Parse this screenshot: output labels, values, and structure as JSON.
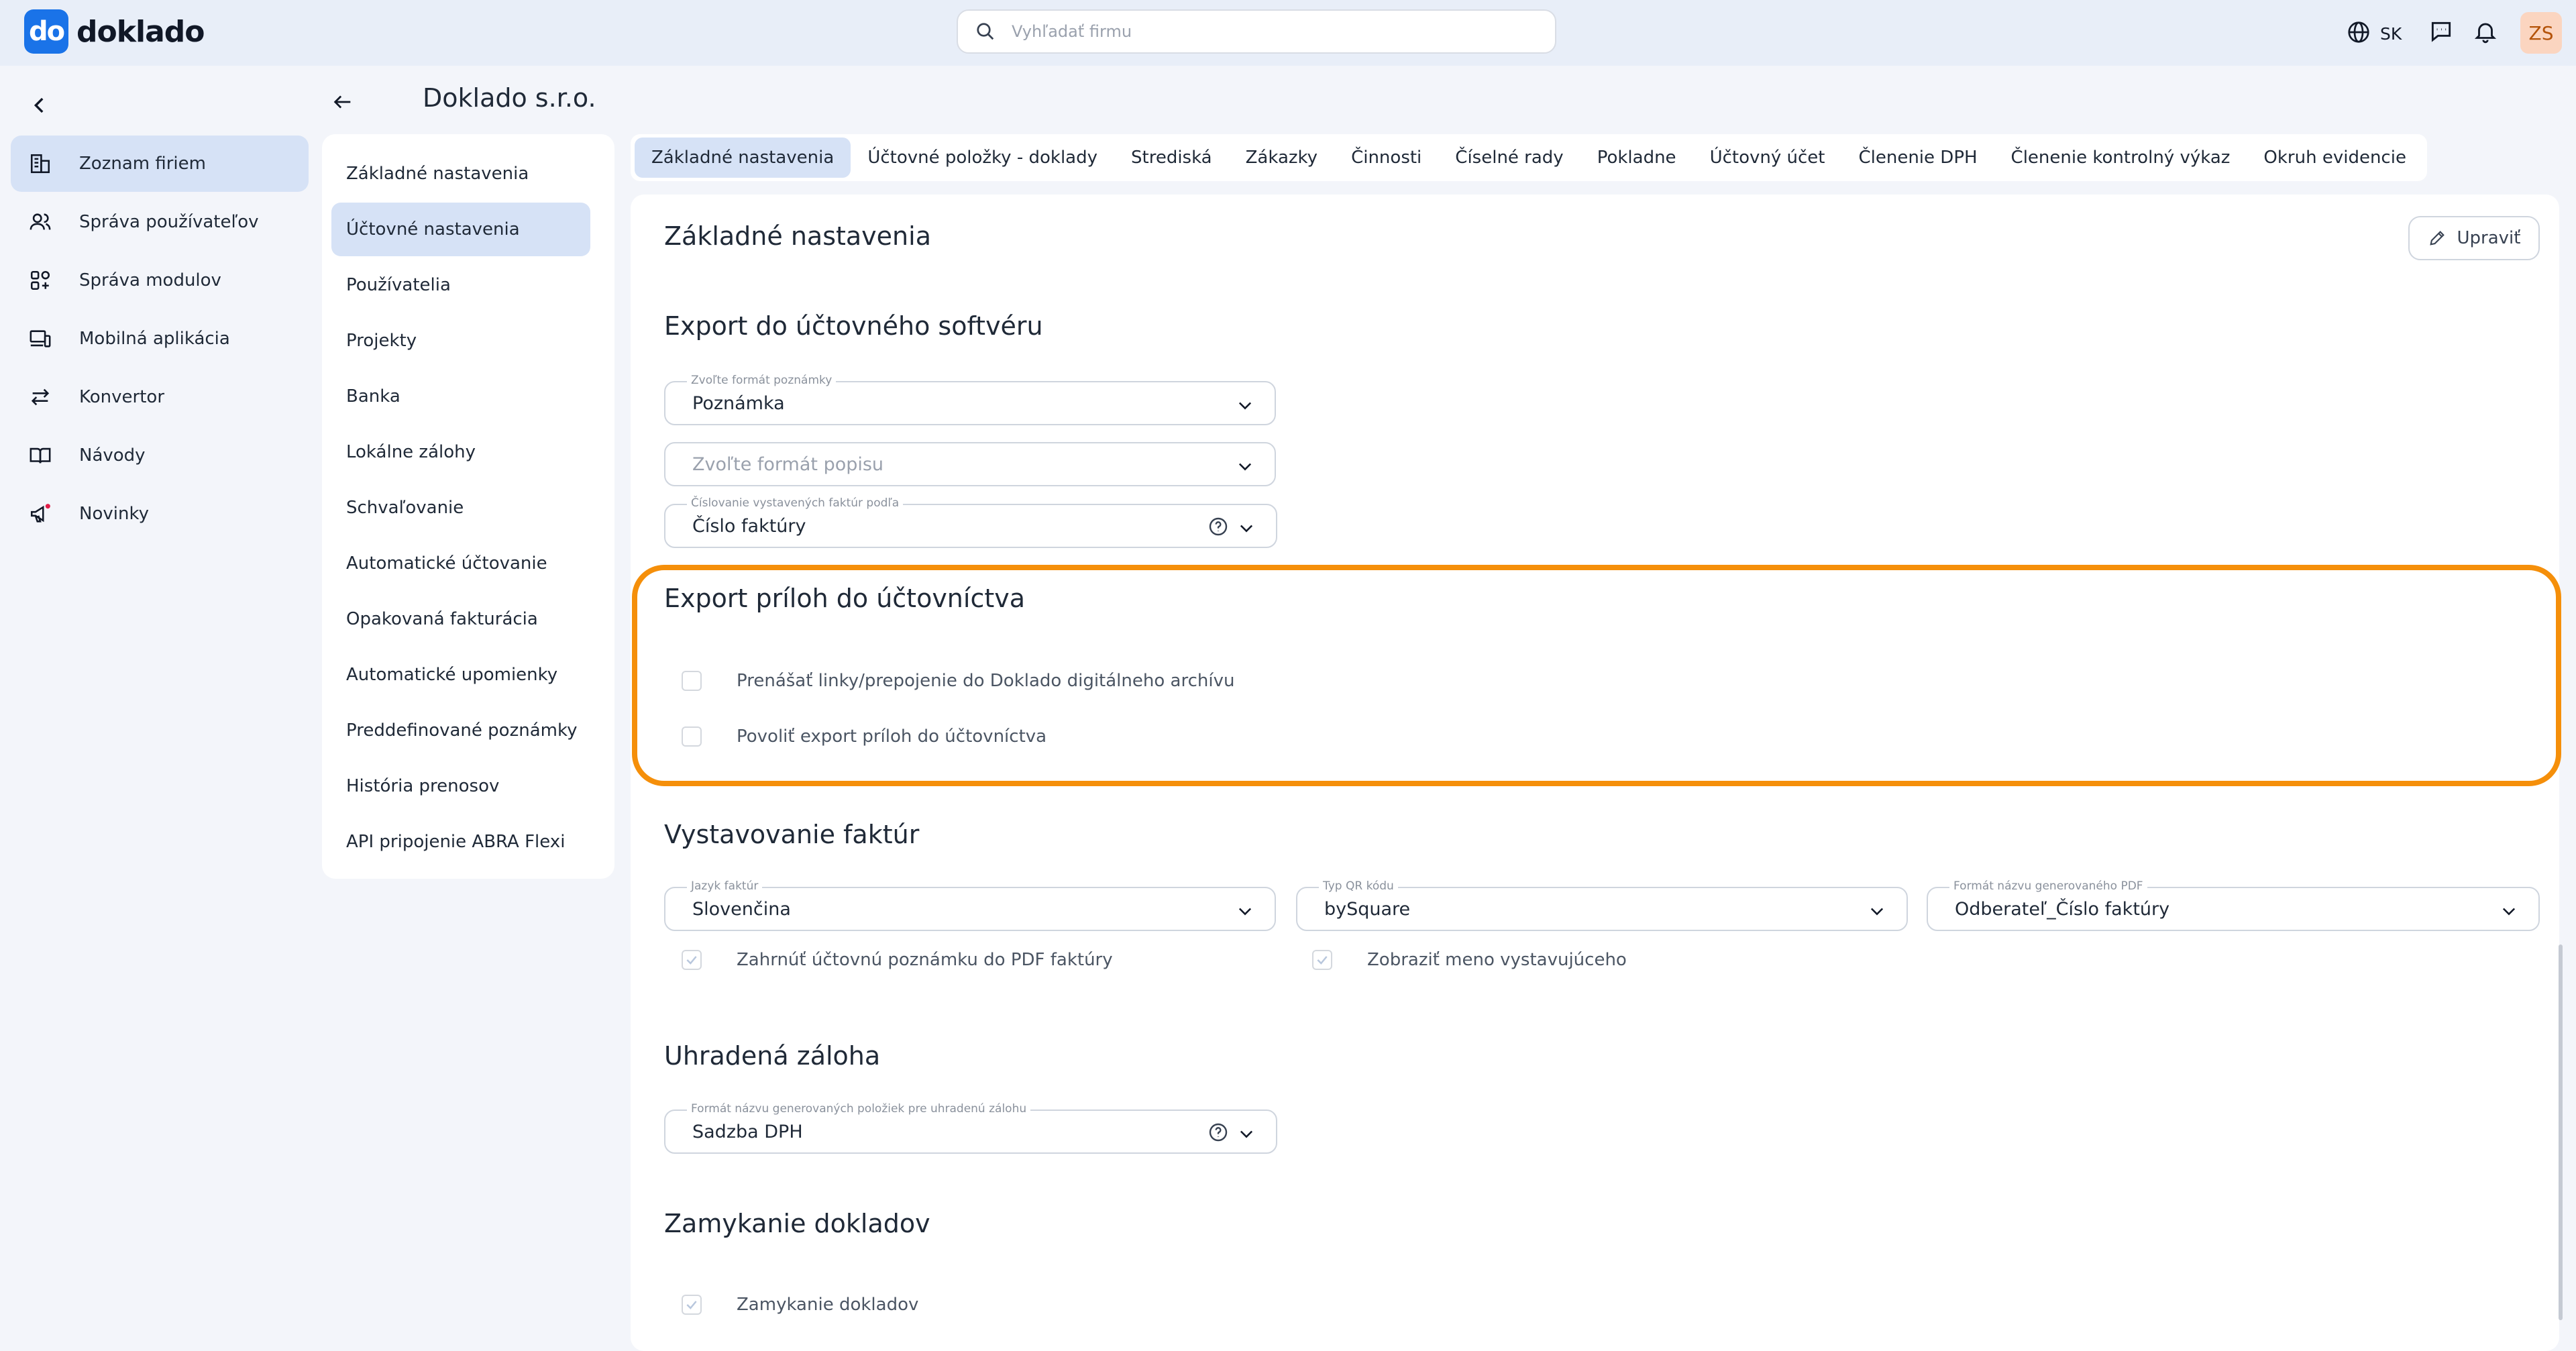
{
  "brand": {
    "logo_mark": "do",
    "name": "doklado"
  },
  "search": {
    "placeholder": "Vyhľadať firmu"
  },
  "header": {
    "lang": "SK",
    "avatar": "ZS"
  },
  "nav": {
    "items": [
      {
        "label": "Zoznam firiem",
        "icon": "building-icon"
      },
      {
        "label": "Správa používateľov",
        "icon": "users-icon"
      },
      {
        "label": "Správa modulov",
        "icon": "modules-icon"
      },
      {
        "label": "Mobilná aplikácia",
        "icon": "devices-icon"
      },
      {
        "label": "Konvertor",
        "icon": "convert-icon"
      },
      {
        "label": "Návody",
        "icon": "book-icon"
      },
      {
        "label": "Novinky",
        "icon": "megaphone-icon"
      }
    ]
  },
  "company": {
    "title": "Doklado s.r.o."
  },
  "submenu": {
    "items": [
      "Základné nastavenia",
      "Účtovné nastavenia",
      "Používatelia",
      "Projekty",
      "Banka",
      "Lokálne zálohy",
      "Schvaľovanie",
      "Automatické účtovanie",
      "Opakovaná fakturácia",
      "Automatické upomienky",
      "Preddefinované poznámky",
      "História prenosov",
      "API pripojenie ABRA Flexi"
    ]
  },
  "tabs": [
    "Základné nastavenia",
    "Účtovné položky - doklady",
    "Strediská",
    "Zákazky",
    "Činnosti",
    "Číselné rady",
    "Pokladne",
    "Účtovný účet",
    "Členenie DPH",
    "Členenie kontrolný výkaz",
    "Okruh evidencie"
  ],
  "main": {
    "title": "Základné nastavenia",
    "edit_label": "Upraviť",
    "export": {
      "title": "Export do účtovného softvéru",
      "note_format": {
        "label": "Zvoľte formát poznámky",
        "value": "Poznámka"
      },
      "desc_format": {
        "placeholder": "Zvoľte formát popisu"
      },
      "numbering": {
        "label": "Číslovanie vystavených faktúr podľa",
        "value": "Číslo faktúry"
      }
    },
    "attachments": {
      "title": "Export príloh do účtovníctva",
      "opt1": "Prenášať linky/prepojenie do Doklado digitálneho archívu",
      "opt2": "Povoliť export príloh do účtovníctva"
    },
    "invoicing": {
      "title": "Vystavovanie faktúr",
      "lang": {
        "label": "Jazyk faktúr",
        "value": "Slovenčina"
      },
      "qr": {
        "label": "Typ QR kódu",
        "value": "bySquare"
      },
      "pdf": {
        "label": "Formát názvu generovaného PDF",
        "value": "Odberateľ_Číslo faktúry"
      },
      "chk1": "Zahrnúť účtovnú poznámku do PDF faktúry",
      "chk2": "Zobraziť meno vystavujúceho"
    },
    "deposit": {
      "title": "Uhradená záloha",
      "format": {
        "label": "Formát názvu generovaných položiek pre uhradenú zálohu",
        "value": "Sadzba DPH"
      }
    },
    "locking": {
      "title": "Zamykanie dokladov",
      "chk": "Zamykanie dokladov"
    }
  },
  "colors": {
    "accent": "#1a73e8",
    "active_bg": "#d6e2f6",
    "highlight": "#f58f0a"
  }
}
